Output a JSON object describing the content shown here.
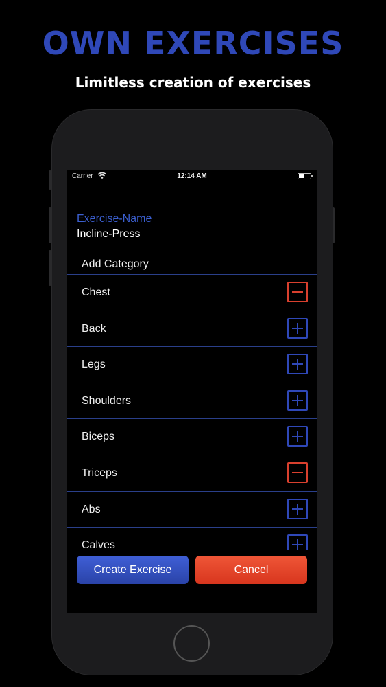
{
  "promo": {
    "headline": "OWN EXERCISES",
    "subline": "Limitless creation of exercises"
  },
  "status_bar": {
    "carrier": "Carrier",
    "time": "12:14 AM"
  },
  "form": {
    "name_label": "Exercise-Name",
    "name_value": "Incline-Press",
    "add_category": "Add Category"
  },
  "categories": [
    {
      "label": "Chest",
      "state": "selected"
    },
    {
      "label": "Back",
      "state": "add"
    },
    {
      "label": "Legs",
      "state": "add"
    },
    {
      "label": "Shoulders",
      "state": "add"
    },
    {
      "label": "Biceps",
      "state": "add"
    },
    {
      "label": "Triceps",
      "state": "selected"
    },
    {
      "label": "Abs",
      "state": "add"
    },
    {
      "label": "Calves",
      "state": "add"
    }
  ],
  "actions": {
    "create": "Create Exercise",
    "cancel": "Cancel"
  },
  "colors": {
    "accent_blue": "#2f48b8",
    "accent_red": "#d9402e"
  }
}
